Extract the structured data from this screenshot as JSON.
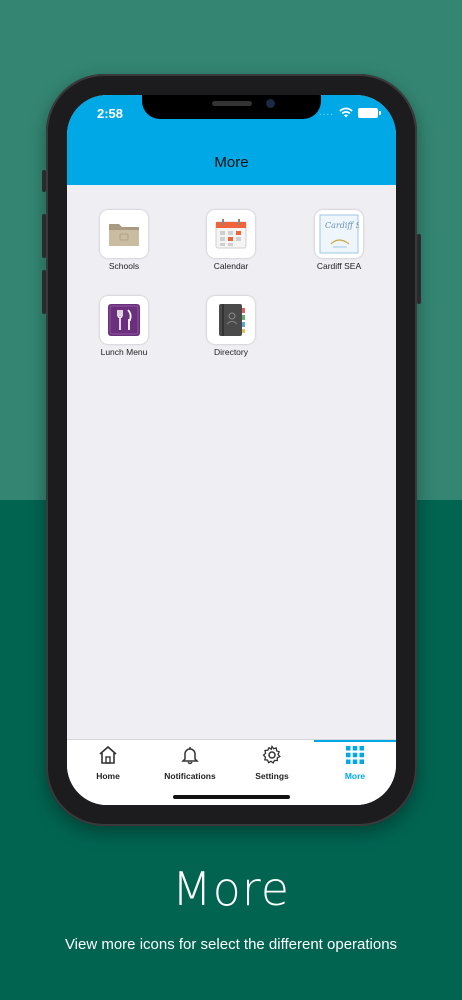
{
  "status": {
    "time": "2:58",
    "signal_dots": "...."
  },
  "nav": {
    "title": "More"
  },
  "tiles": [
    {
      "label": "Schools",
      "icon": "folder-icon"
    },
    {
      "label": "Calendar",
      "icon": "calendar-icon"
    },
    {
      "label": "Cardiff SEA",
      "icon": "cardiff-sea-logo",
      "logo_text": "Cardiff SEA"
    },
    {
      "label": "Lunch Menu",
      "icon": "fork-knife-icon"
    },
    {
      "label": "Directory",
      "icon": "book-icon"
    }
  ],
  "tabbar": {
    "items": [
      {
        "label": "Home",
        "icon": "home-icon"
      },
      {
        "label": "Notifications",
        "icon": "bell-icon"
      },
      {
        "label": "Settings",
        "icon": "gear-icon"
      },
      {
        "label": "More",
        "icon": "grid-icon",
        "active": true
      }
    ]
  },
  "caption": {
    "headline": "More",
    "subline": "View more icons for select the different operations"
  },
  "colors": {
    "accent": "#00a8e6",
    "background_top": "#348673",
    "background_bottom": "#006451"
  }
}
